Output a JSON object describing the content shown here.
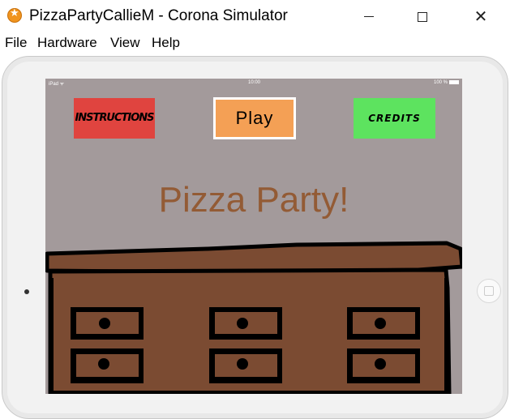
{
  "window": {
    "title": "PizzaPartyCallieM - Corona Simulator",
    "minimize_icon": "minimize-icon",
    "maximize_icon": "maximize-icon",
    "close_glyph": "✕"
  },
  "menu": {
    "items": [
      "File",
      "Hardware",
      "View",
      "Help"
    ]
  },
  "status_bar": {
    "carrier": "iPad ᯤ",
    "time": "10:00",
    "battery": "100 %"
  },
  "game": {
    "instructions_label": "INSTRUCTIONS",
    "play_label": "Play",
    "credits_label": "CREDITS",
    "title": "Pizza Party!"
  },
  "colors": {
    "screen_background": "#a39a9b",
    "instructions_button": "#e0443f",
    "play_button": "#f4a055",
    "credits_button": "#5de35f",
    "title_text": "#935b35",
    "desk_wood": "#7b4b32",
    "desk_outline": "#000000"
  }
}
